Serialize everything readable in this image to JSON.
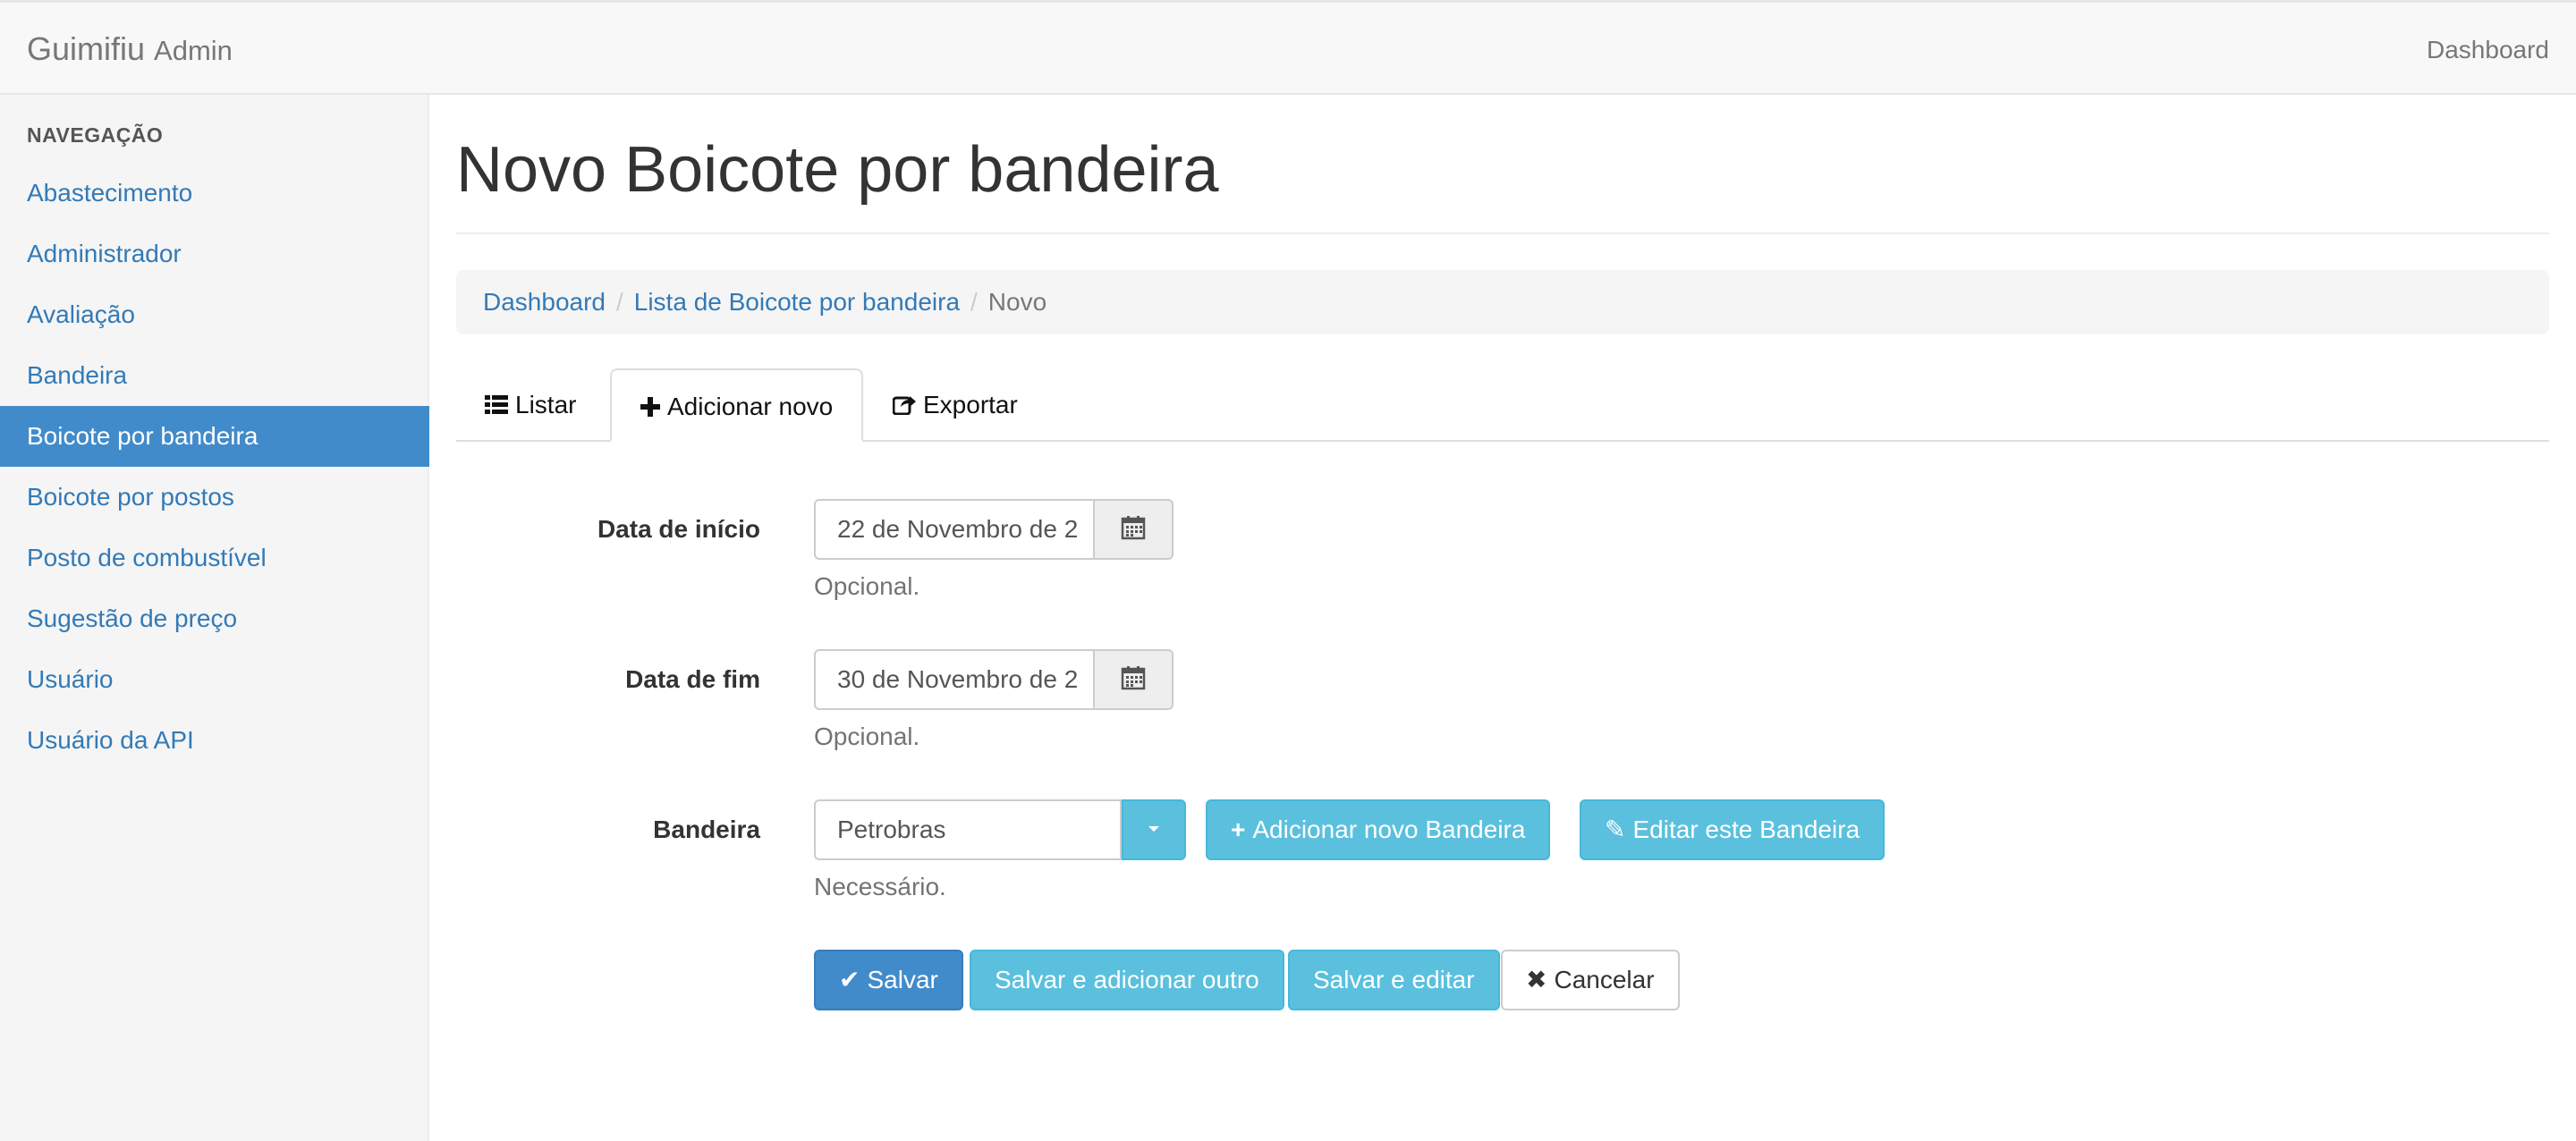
{
  "navbar": {
    "brand": "Guimifiu",
    "brand_sub": "Admin",
    "right_link": "Dashboard"
  },
  "sidebar": {
    "header": "NAVEGAÇÃO",
    "items": [
      {
        "label": "Abastecimento"
      },
      {
        "label": "Administrador"
      },
      {
        "label": "Avaliação"
      },
      {
        "label": "Bandeira"
      },
      {
        "label": "Boicote por bandeira",
        "active": true
      },
      {
        "label": "Boicote por postos"
      },
      {
        "label": "Posto de combustível"
      },
      {
        "label": "Sugestão de preço"
      },
      {
        "label": "Usuário"
      },
      {
        "label": "Usuário da API"
      }
    ]
  },
  "page": {
    "title": "Novo Boicote por bandeira"
  },
  "breadcrumb": {
    "items": [
      "Dashboard",
      "Lista de Boicote por bandeira"
    ],
    "active": "Novo",
    "separator": "/"
  },
  "tabs": {
    "list": "Listar",
    "add": "Adicionar novo",
    "export": "Exportar"
  },
  "form": {
    "start_date": {
      "label": "Data de início",
      "value": "22 de Novembro de 2",
      "help": "Opcional."
    },
    "end_date": {
      "label": "Data de fim",
      "value": "30 de Novembro de 2",
      "help": "Opcional."
    },
    "bandeira": {
      "label": "Bandeira",
      "value": "Petrobras",
      "help": "Necessário.",
      "add_label": "Adicionar novo Bandeira",
      "edit_label": "Editar este Bandeira"
    },
    "actions": {
      "save": "Salvar",
      "save_add": "Salvar e adicionar outro",
      "save_edit": "Salvar e editar",
      "cancel": "Cancelar"
    }
  },
  "colors": {
    "primary": "#428bca",
    "info": "#5bc0de",
    "link": "#337ab7"
  }
}
